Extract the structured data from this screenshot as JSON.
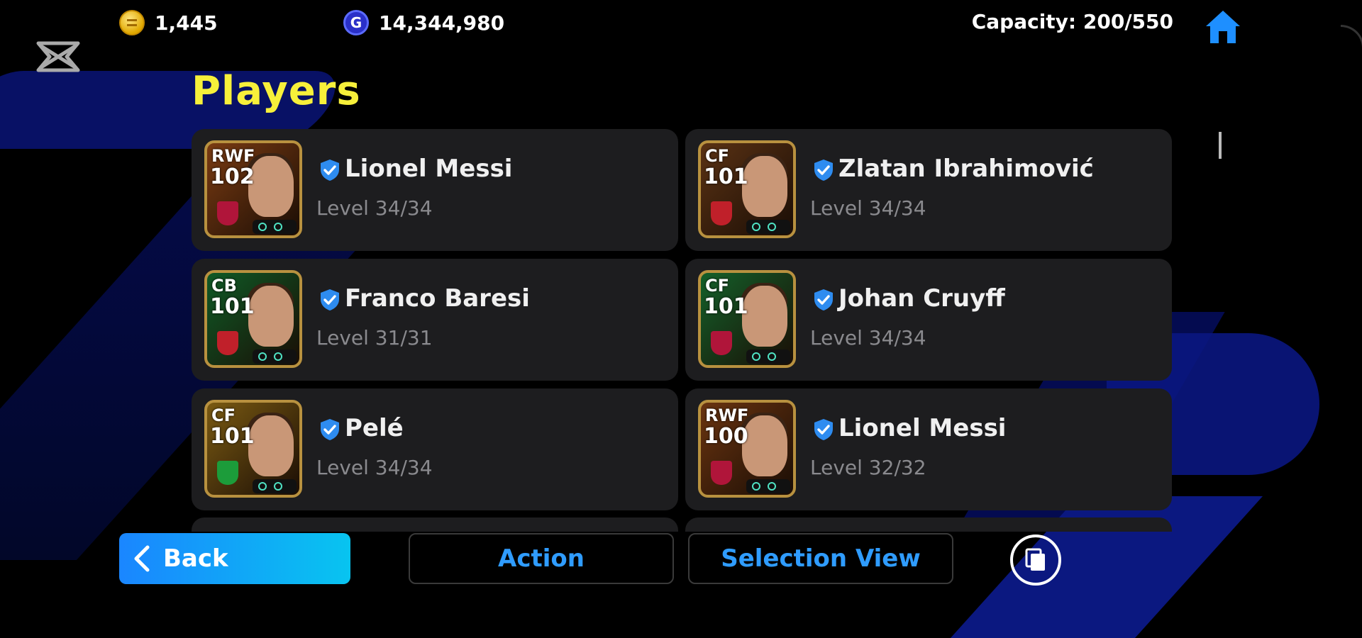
{
  "header": {
    "coins": "1,445",
    "gp": "14,344,980",
    "gp_icon_letter": "G",
    "capacity": "Capacity: 200/550"
  },
  "page_title": "Players",
  "players": [
    {
      "position": "RWF",
      "rating": "102",
      "name": "Lionel Messi",
      "level": "Level 34/34",
      "bg": "#7a3b12",
      "crest": "#b0153a"
    },
    {
      "position": "CF",
      "rating": "101",
      "name": "Zlatan Ibrahimović",
      "level": "Level 34/34",
      "bg": "#5a3214",
      "crest": "#c0202a"
    },
    {
      "position": "CB",
      "rating": "101",
      "name": "Franco Baresi",
      "level": "Level 31/31",
      "bg": "#0f5a26",
      "crest": "#c0202a"
    },
    {
      "position": "CF",
      "rating": "101",
      "name": "Johan Cruyff",
      "level": "Level 34/34",
      "bg": "#14602a",
      "crest": "#b0153a"
    },
    {
      "position": "CF",
      "rating": "101",
      "name": "Pelé",
      "level": "Level 34/34",
      "bg": "#7a5a12",
      "crest": "#1c9c3a"
    },
    {
      "position": "RWF",
      "rating": "100",
      "name": "Lionel Messi",
      "level": "Level 32/32",
      "bg": "#6a3410",
      "crest": "#b0153a"
    }
  ],
  "footer": {
    "back": "Back",
    "action": "Action",
    "selection_view": "Selection View"
  },
  "colors": {
    "title": "#f7f03a",
    "accent": "#2f9cff",
    "card": "#1d1d1f"
  }
}
